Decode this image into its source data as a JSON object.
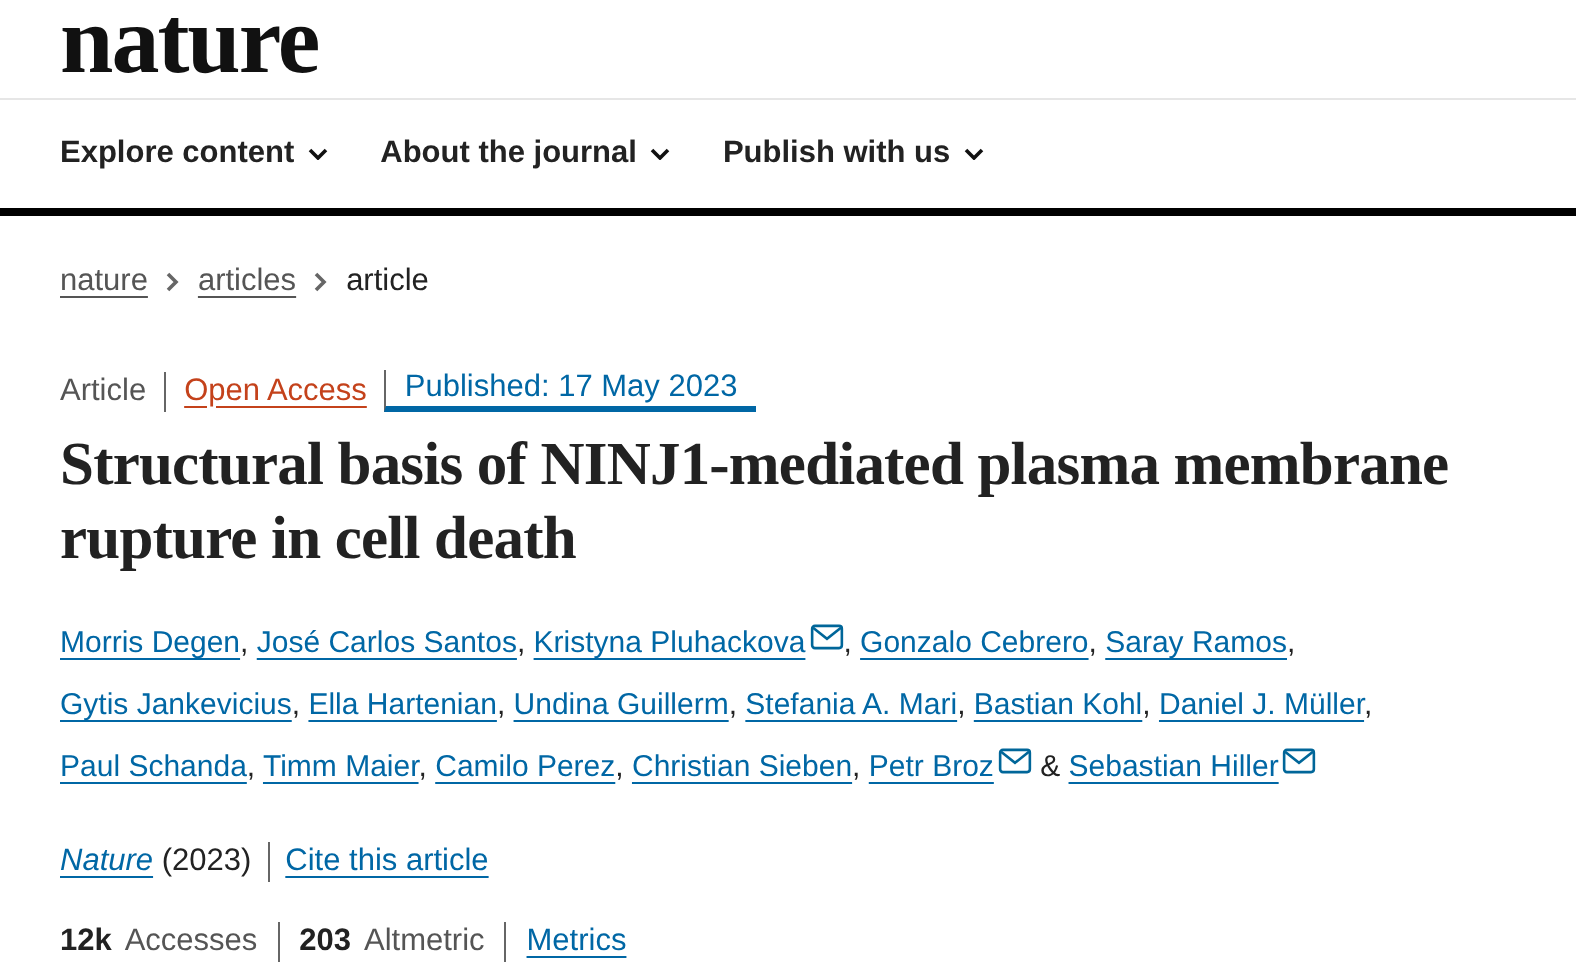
{
  "logo": "nature",
  "nav": [
    {
      "label": "Explore content"
    },
    {
      "label": "About the journal"
    },
    {
      "label": "Publish with us"
    }
  ],
  "breadcrumbs": [
    {
      "label": "nature",
      "kind": "link"
    },
    {
      "label": "articles",
      "kind": "link"
    },
    {
      "label": "article",
      "kind": "current"
    }
  ],
  "meta": [
    {
      "label": "Article",
      "kind": "text"
    },
    {
      "label": "Open Access",
      "kind": "access"
    },
    {
      "label": "Published: 17 May 2023",
      "kind": "date"
    }
  ],
  "title": "Structural basis of NINJ1-mediated plasma membrane rupture in cell death",
  "authors": [
    {
      "name": "Morris Degen",
      "email": false,
      "sep": ","
    },
    {
      "name": "José Carlos Santos",
      "email": false,
      "sep": ","
    },
    {
      "name": "Kristyna Pluhackova",
      "email": true,
      "sep": ","
    },
    {
      "name": "Gonzalo Cebrero",
      "email": false,
      "sep": ","
    },
    {
      "name": "Saray Ramos",
      "email": false,
      "sep": ","
    },
    {
      "name": "Gytis Jankevicius",
      "email": false,
      "sep": ","
    },
    {
      "name": "Ella Hartenian",
      "email": false,
      "sep": ","
    },
    {
      "name": "Undina Guillerm",
      "email": false,
      "sep": ","
    },
    {
      "name": "Stefania A. Mari",
      "email": false,
      "sep": ","
    },
    {
      "name": "Bastian Kohl",
      "email": false,
      "sep": ","
    },
    {
      "name": "Daniel J. Müller",
      "email": false,
      "sep": ","
    },
    {
      "name": "Paul Schanda",
      "email": false,
      "sep": ","
    },
    {
      "name": "Timm Maier",
      "email": false,
      "sep": ","
    },
    {
      "name": "Camilo Perez",
      "email": false,
      "sep": ","
    },
    {
      "name": "Christian Sieben",
      "email": false,
      "sep": ","
    },
    {
      "name": "Petr Broz",
      "email": true,
      "sep": "&"
    },
    {
      "name": "Sebastian Hiller",
      "email": true
    }
  ],
  "citation": {
    "journal": "Nature",
    "year": "(2023)",
    "cite": "Cite this article"
  },
  "metrics": [
    {
      "count": "12k",
      "name": "Accesses"
    },
    {
      "count": "203",
      "name": "Altmetric"
    }
  ],
  "metrics_link": "Metrics"
}
